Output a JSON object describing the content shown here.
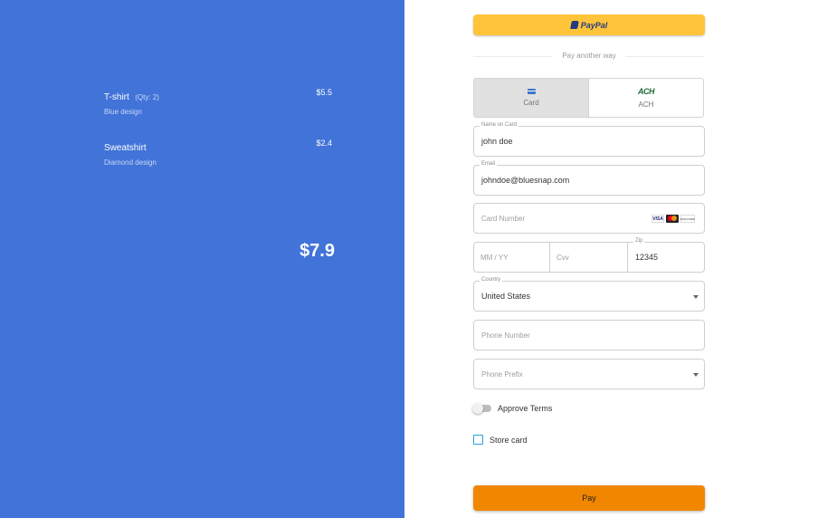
{
  "summary": {
    "items": [
      {
        "name": "T-shirt",
        "qty": "(Qty: 2)",
        "desc": "Blue design",
        "price": "$5.5"
      },
      {
        "name": "Sweatshirt",
        "qty": "",
        "desc": "Diamond design",
        "price": "$2.4"
      }
    ],
    "total": "$7.9"
  },
  "paypal": {
    "label": "PayPal"
  },
  "divider_text": "Pay another way",
  "tabs": [
    {
      "label": "Card",
      "icon": "credit-card-icon",
      "active": true
    },
    {
      "label": "ACH",
      "icon": "ach-icon",
      "icon_text": "ACH",
      "active": false
    }
  ],
  "form": {
    "name": {
      "label": "Name on Card",
      "value": "john doe"
    },
    "email": {
      "label": "Email",
      "value": "johndoe@bluesnap.com"
    },
    "card_number": {
      "placeholder": "Card Number",
      "brands": [
        "VISA",
        "mastercard",
        "DISCOVER"
      ]
    },
    "expiry": {
      "placeholder": "MM / YY"
    },
    "cvv": {
      "placeholder": "Cvv"
    },
    "zip": {
      "label": "Zip",
      "value": "12345"
    },
    "country": {
      "label": "Country",
      "value": "United States"
    },
    "phone": {
      "placeholder": "Phone Number"
    },
    "phone_prefix": {
      "placeholder": "Phone Prefix"
    }
  },
  "approve_terms": {
    "label": "Approve Terms",
    "checked": false
  },
  "store_card": {
    "label": "Store card",
    "checked": false
  },
  "pay_button": {
    "label": "Pay"
  },
  "colors": {
    "left_panel": "#4173d8",
    "paypal": "#ffc43a",
    "pay": "#f18700",
    "checkbox": "#2a9fd8"
  }
}
